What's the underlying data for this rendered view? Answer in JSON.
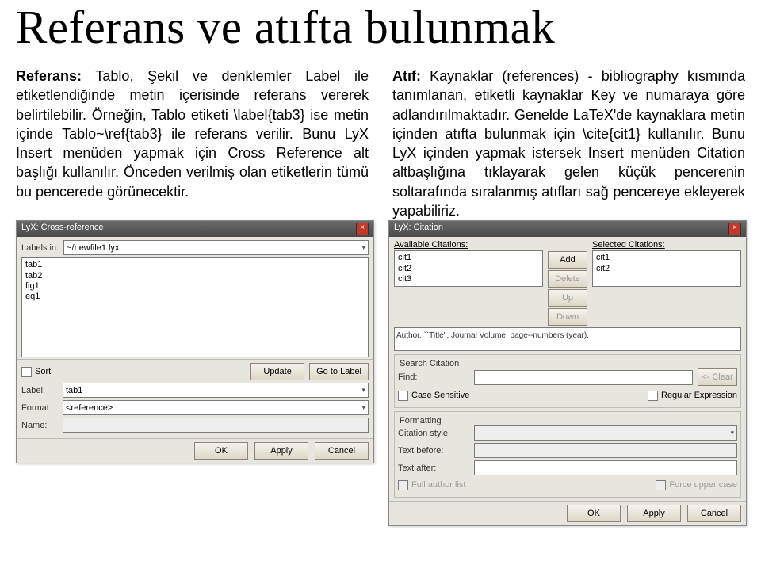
{
  "title": "Referans ve atıfta bulunmak",
  "left_text": "Referans: Tablo, Şekil ve denklemler Label ile etiketlendiğinde metin içerisinde referans vererek belirtilebilir. Örneğin, Tablo etiketi \\label{tab3} ise metin içinde Tablo~\\ref{tab3} ile referans verilir. Bunu LyX Insert menüden yapmak için Cross Reference alt başlığı kullanılır. Önceden verilmiş olan etiketlerin tümü bu pencerede görünecektir.",
  "right_text": "Atıf: Kaynaklar (references) - bibliography kısmında tanımlanan, etiketli kaynaklar Key ve numaraya göre adlandırılmaktadır. Genelde LaTeX'de kaynaklara metin içinden atıfta bulunmak için \\cite{cit1} kullanılır. Bunu LyX içinden yapmak istersek Insert menüden Citation altbaşlığına tıklayarak gelen küçük pencerenin soltarafında sıralanmış atıfları sağ pencereye ekleyerek yapabiliriz.",
  "crossref": {
    "window_title": "LyX: Cross-reference",
    "labels_in": "Labels in:",
    "file": "~/newfile1.lyx",
    "items": [
      "tab1",
      "tab2",
      "fig1",
      "eq1"
    ],
    "sort": "Sort",
    "update": "Update",
    "goto_label": "Go to Label",
    "label_lbl": "Label:",
    "label_val": "tab1",
    "format_lbl": "Format:",
    "format_val": "<reference>",
    "name_lbl": "Name:",
    "ok": "OK",
    "apply": "Apply",
    "cancel": "Cancel"
  },
  "citation": {
    "window_title": "LyX: Citation",
    "avail": "Available Citations:",
    "selected": "Selected Citations:",
    "avail_items": [
      "cit1",
      "cit2",
      "cit3"
    ],
    "sel_items": [
      "cit1",
      "cit2"
    ],
    "add": "Add",
    "delete": "Delete",
    "up": "Up",
    "down": "Down",
    "author_line": "Author, ``Title'', Journal Volume, page--numbers (year).",
    "search_section": "Search Citation",
    "find": "Find:",
    "clear": "<- Clear",
    "case_sensitive": "Case Sensitive",
    "regex": "Regular Expression",
    "formatting_section": "Formatting",
    "citation_style": "Citation style:",
    "text_before": "Text before:",
    "text_after": "Text after:",
    "full_author": "Full author list",
    "force_upper": "Force upper case",
    "ok": "OK",
    "apply": "Apply",
    "cancel": "Cancel"
  }
}
